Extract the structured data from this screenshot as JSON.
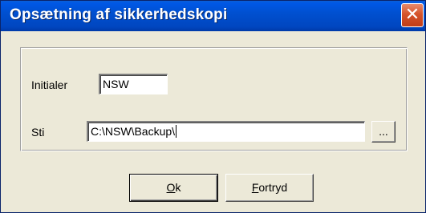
{
  "window": {
    "title": "Opsætning af sikkerhedskopi",
    "close_glyph": "✕"
  },
  "form": {
    "initialer_label": "Initialer",
    "initialer_value": "NSW",
    "sti_label": "Sti",
    "sti_value": "C:\\NSW\\Backup\\",
    "browse_label": "..."
  },
  "buttons": {
    "ok_mnemonic": "O",
    "ok_rest": "k",
    "cancel_mnemonic": "F",
    "cancel_rest": "ortryd"
  },
  "colors": {
    "titlebar": "#0050d0",
    "close_button": "#d5542b",
    "dialog_face": "#ece9d8"
  },
  "icons": {
    "close": "close-icon"
  }
}
